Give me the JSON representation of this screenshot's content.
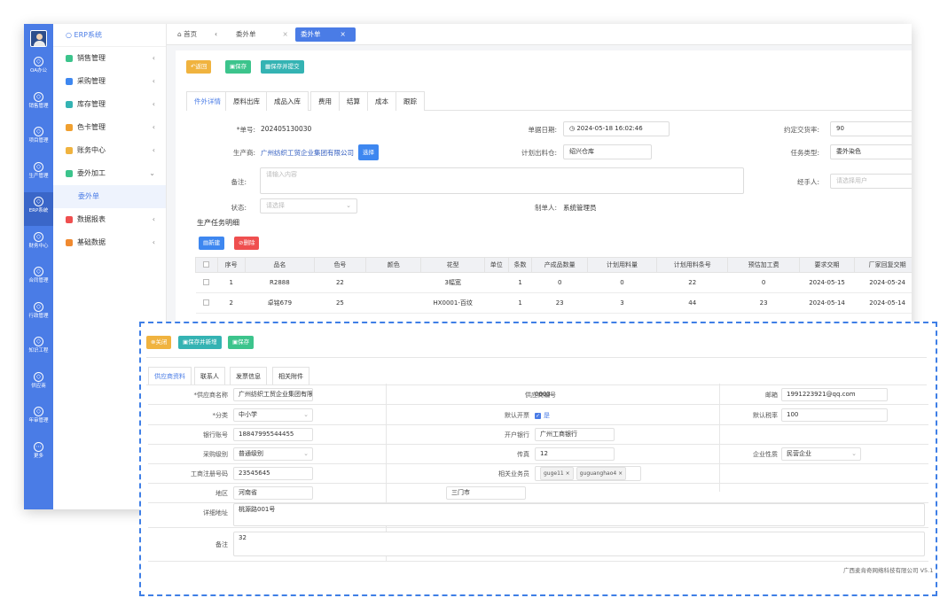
{
  "rail": [
    {
      "label": "OA办公",
      "icon": "cube-icon"
    },
    {
      "label": "销售管理",
      "icon": "cube-icon"
    },
    {
      "label": "项目管理",
      "icon": "cube-icon"
    },
    {
      "label": "生产管理",
      "icon": "cube-icon"
    },
    {
      "label": "ERP系统",
      "icon": "cube-icon"
    },
    {
      "label": "财务中心",
      "icon": "cube-icon"
    },
    {
      "label": "合同管理",
      "icon": "cube-icon"
    },
    {
      "label": "行政管理",
      "icon": "cube-icon"
    },
    {
      "label": "知识工程",
      "icon": "cube-icon"
    },
    {
      "label": "供应商",
      "icon": "cube-icon"
    },
    {
      "label": "年审管理",
      "icon": "cube-icon"
    },
    {
      "label": "更多",
      "icon": "more-icon"
    }
  ],
  "sidebar": {
    "header": "○ ERP系统",
    "items": [
      {
        "label": "销售管理",
        "color": "#3cc48c",
        "arrow": "‹"
      },
      {
        "label": "采购管理",
        "color": "#3e87f0",
        "arrow": "‹"
      },
      {
        "label": "库存管理",
        "color": "#34b3b3",
        "arrow": "‹"
      },
      {
        "label": "色卡管理",
        "color": "#f0a030",
        "arrow": "‹"
      },
      {
        "label": "账务中心",
        "color": "#f0b33f",
        "arrow": "‹"
      },
      {
        "label": "委外加工",
        "color": "#3cc48c",
        "arrow": "⌄"
      },
      {
        "label": "委外单",
        "color": "",
        "arrow": ""
      },
      {
        "label": "数据报表",
        "color": "#ef4f4f",
        "arrow": "‹"
      },
      {
        "label": "基础数据",
        "color": "#f08a30",
        "arrow": "‹"
      }
    ]
  },
  "tabs": {
    "home": "首页",
    "back": "‹",
    "t1": "委外单",
    "t1_close": "×",
    "t2": "委外单",
    "t2_close": "×"
  },
  "toolbar": {
    "back": "返回",
    "save": "保存",
    "save_submit": "保存并提交"
  },
  "subtabs": [
    "件外详情",
    "原料出库",
    "成品入库",
    "费用",
    "结算",
    "成本",
    "跟踪"
  ],
  "form": {
    "order_no_label": "*单号:",
    "order_no": "202405130030",
    "date_label": "单据日期:",
    "date": "2024-05-18 16:02:46",
    "rate_label": "约定交货率:",
    "rate": "90",
    "producer_label": "生产商:",
    "producer": "广州纺织工贸企业集团有限公司",
    "choose": "选择",
    "warehouse_label": "计划出料仓:",
    "warehouse": "绍兴仓库",
    "task_type_label": "任务类型:",
    "task_type": "委外染色",
    "note_label": "备注:",
    "note_ph": "请输入内容",
    "handler_label": "经手人:",
    "handler_ph": "请选择用户",
    "status_label": "状态:",
    "status_ph": "请选择",
    "creator_label": "制单人:",
    "creator": "系统管理员"
  },
  "section": {
    "title": "生产任务明细",
    "new": "新建",
    "del": "删除"
  },
  "table": {
    "headers": [
      "序号",
      "品名",
      "色号",
      "颜色",
      "花型",
      "单位",
      "条数",
      "产成品数量",
      "计划用料量",
      "计划用料条号",
      "预估加工费",
      "要求交期",
      "厂家回复交期"
    ],
    "rows": [
      [
        "1",
        "R2888",
        "22",
        "",
        "3幅宽",
        "",
        "1",
        "0",
        "0",
        "22",
        "0",
        "2024-05-15",
        "2024-05-24"
      ],
      [
        "2",
        "卓铭679",
        "25",
        "",
        "HX0001-百纹",
        "",
        "1",
        "23",
        "3",
        "44",
        "23",
        "2024-05-14",
        "2024-05-14"
      ]
    ]
  },
  "popup": {
    "btn_close": "关闭",
    "btn_save_new": "保存并新增",
    "btn_save": "保存",
    "tabs": [
      "供应商资料",
      "联系人",
      "发票信息",
      "相关附件"
    ],
    "name_label": "*供应商名称",
    "name": "广州纺织工贸企业集团有限",
    "code_label": "供应商编号",
    "code": "0003",
    "email_label": "邮箱",
    "email": "1991223921@qq.com",
    "cat_label": "*分类",
    "cat": "中小学",
    "default_label": "默认开票",
    "default_val": "是",
    "rate_label": "默认税率",
    "rate": "100",
    "acct_label": "银行账号",
    "acct": "18847995544455",
    "bank_label": "开户银行",
    "bank": "广州工商银行",
    "level_label": "采购级别",
    "level": "普通级别",
    "fax_label": "传真",
    "fax": "12",
    "nature_label": "企业性质",
    "nature": "民营企业",
    "license_label": "工商注册号码",
    "license": "23545645",
    "biz_label": "相关业务员",
    "biz_tags": [
      "guge11",
      "guguanghao4"
    ],
    "prov_label": "地区",
    "prov": "河南省",
    "city": "三门市",
    "addr_label": "详细地址",
    "addr": "桃源路001号",
    "remark_label": "备注",
    "remark": "32",
    "footer": "广西麦肯奇网络科技有限公司 V5.1"
  }
}
